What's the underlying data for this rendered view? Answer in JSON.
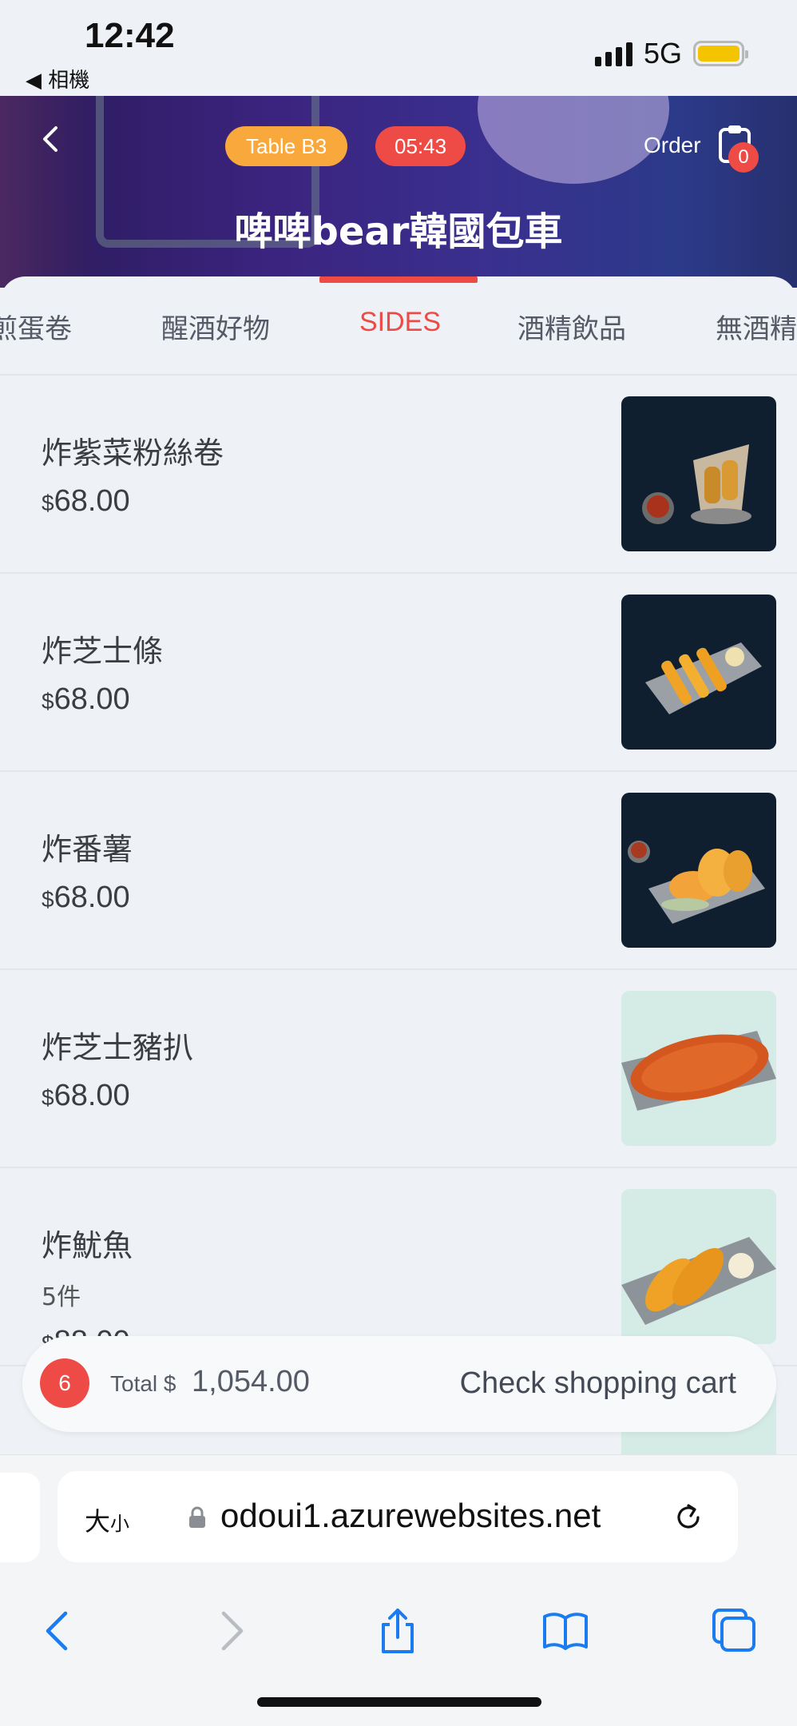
{
  "status_bar": {
    "time": "12:42",
    "back_app": "◀ 相機",
    "network": "5G"
  },
  "header": {
    "table_label": "Table  B3",
    "timer": "05:43",
    "order_label": "Order",
    "order_count": "0",
    "store_name": "啤啤bear韓國包車"
  },
  "tabs": [
    {
      "label": "煎蛋卷"
    },
    {
      "label": "醒酒好物"
    },
    {
      "label": "SIDES",
      "active": true
    },
    {
      "label": "酒精飲品"
    },
    {
      "label": "無酒精"
    }
  ],
  "menu": {
    "items": [
      {
        "name": "炸紫菜粉絲卷",
        "currency": "$",
        "price": "68.00"
      },
      {
        "name": "炸芝士條",
        "currency": "$",
        "price": "68.00"
      },
      {
        "name": "炸番薯",
        "currency": "$",
        "price": "68.00"
      },
      {
        "name": "炸芝士豬扒",
        "currency": "$",
        "price": "68.00"
      },
      {
        "name": "炸魷魚",
        "subtitle": "5件",
        "currency": "$",
        "price": "88.00"
      }
    ]
  },
  "cart": {
    "count": "6",
    "total_label": "Total $",
    "total_amount": "1,054.00",
    "check_label": "Check shopping cart"
  },
  "browser": {
    "text_size_label": "大",
    "text_size_small": "小",
    "url": "odoui1.azurewebsites.net"
  },
  "colors": {
    "accent": "#ee4b47",
    "table_pill": "#f9a83b",
    "ios_blue": "#1a7cf0"
  }
}
